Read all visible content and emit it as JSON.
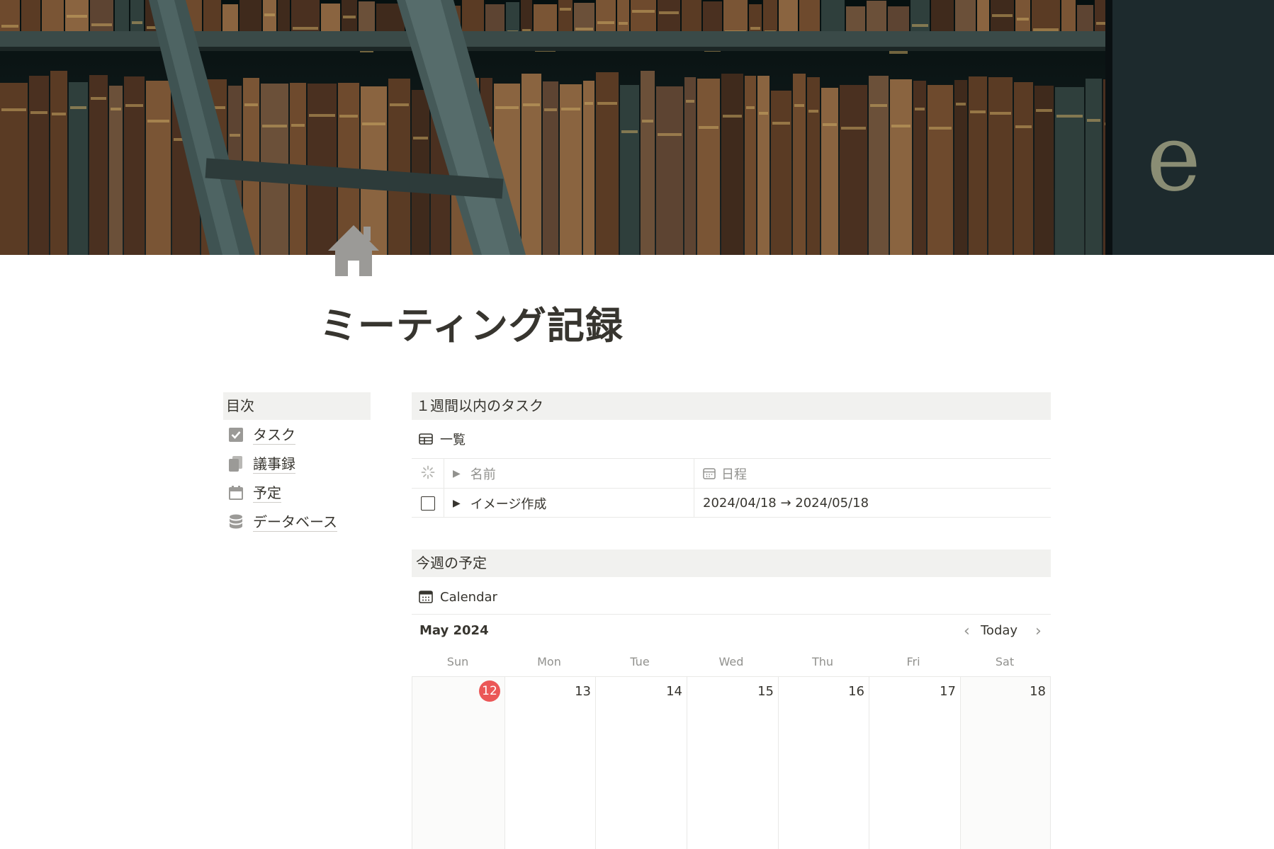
{
  "page": {
    "title": "ミーティング記録",
    "icon": "home-icon",
    "cover": "bookshelf-cover-image"
  },
  "toc": {
    "heading": "目次",
    "items": [
      {
        "label": "タスク",
        "icon": "checkbox-icon"
      },
      {
        "label": "議事録",
        "icon": "documents-icon"
      },
      {
        "label": "予定",
        "icon": "calendar-icon"
      },
      {
        "label": "データベース",
        "icon": "database-icon"
      }
    ]
  },
  "tasks": {
    "heading": "１週間以内のタスク",
    "view_label": "一覧",
    "view_icon": "table-icon",
    "columns": {
      "status_icon": "loading-icon",
      "name": "名前",
      "date": "日程"
    },
    "rows": [
      {
        "name": "イメージ作成",
        "date": "2024/04/18 → 2024/05/18",
        "done": false
      }
    ]
  },
  "schedule": {
    "heading": "今週の予定",
    "view_label": "Calendar",
    "view_icon": "calendar-icon",
    "month": "May 2024",
    "today_label": "Today",
    "weekdays": [
      "Sun",
      "Mon",
      "Tue",
      "Wed",
      "Thu",
      "Fri",
      "Sat"
    ],
    "days": [
      "12",
      "13",
      "14",
      "15",
      "16",
      "17",
      "18"
    ],
    "today": "12"
  },
  "colors": {
    "text": "#37352f",
    "muted": "#91918e",
    "heading_bg": "#f1f1ef",
    "today": "#eb5757",
    "icon_gray": "#9b9a97"
  }
}
